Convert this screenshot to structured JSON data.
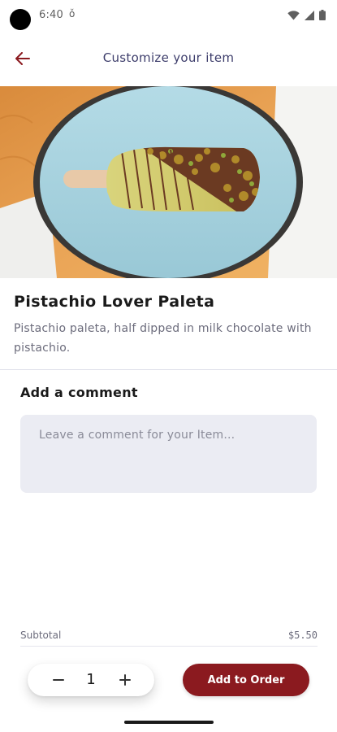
{
  "status_bar": {
    "time": "6:40",
    "extra": "ǒ",
    "icons": [
      "wifi-icon",
      "signal-icon",
      "battery-icon"
    ]
  },
  "header": {
    "back_icon": "arrow-left-icon",
    "title": "Customize your item"
  },
  "product": {
    "image_icon": "pistachio-paleta-photo",
    "name": "Pistachio Lover Paleta",
    "description": "Pistachio paleta, half dipped in milk chocolate with pistachio."
  },
  "comment": {
    "heading": "Add a comment",
    "placeholder": "Leave a comment for your Item...",
    "value": ""
  },
  "subtotal": {
    "label": "Subtotal",
    "value": "$5.50"
  },
  "footer": {
    "quantity": "1",
    "minus_icon": "minus-icon",
    "plus_icon": "plus-icon",
    "add_label": "Add to Order"
  },
  "colors": {
    "accent": "#8b1a1f",
    "title_text": "#3d3d6b",
    "comment_bg": "#ebecf3",
    "plate": "#a9d3e0",
    "wood": "#e9a052"
  }
}
